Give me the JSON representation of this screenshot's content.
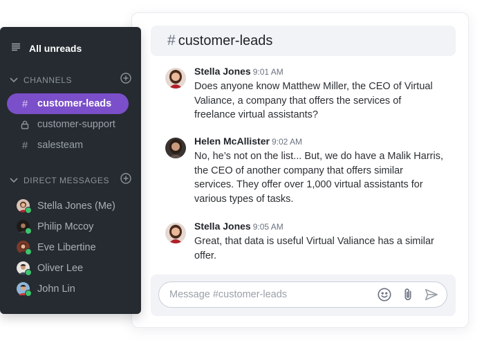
{
  "sidebar": {
    "all_unreads": "All unreads",
    "channels_header": "CHANNELS",
    "channels": [
      {
        "label": "customer-leads",
        "icon": "hash-icon",
        "active": true
      },
      {
        "label": "customer-support",
        "icon": "lock-icon",
        "active": false
      },
      {
        "label": "salesteam",
        "icon": "hash-icon",
        "active": false
      }
    ],
    "dm_header": "DIRECT MESSAGES",
    "direct_messages": [
      {
        "label": "Stella Jones (Me)"
      },
      {
        "label": "Philip Mccoy"
      },
      {
        "label": "Eve Libertine"
      },
      {
        "label": "Oliver Lee"
      },
      {
        "label": "John Lin"
      }
    ]
  },
  "chat": {
    "hash": "#",
    "channel_title": "customer-leads",
    "messages": [
      {
        "author": "Stella Jones",
        "time": "9:01 AM",
        "text": "Does anyone know Matthew Miller, the CEO of Virtual Valiance, a company that offers the services of freelance virtual assistants?"
      },
      {
        "author": "Helen McAllister",
        "time": "9:02 AM",
        "text": "No, he’s not on the list... But, we do have a Malik Harris, the CEO of another company that offers similar services. They offer over 1,000 virtual assistants for various types of tasks."
      },
      {
        "author": "Stella Jones",
        "time": "9:05 AM",
        "text": "Great, that data is useful Virtual Valiance has a similar offer."
      }
    ],
    "composer": {
      "placeholder": "Message #customer-leads",
      "value": ""
    }
  },
  "colors": {
    "sidebar_bg": "#252b30",
    "accent": "#7b4fc9",
    "online": "#3ec46d"
  }
}
